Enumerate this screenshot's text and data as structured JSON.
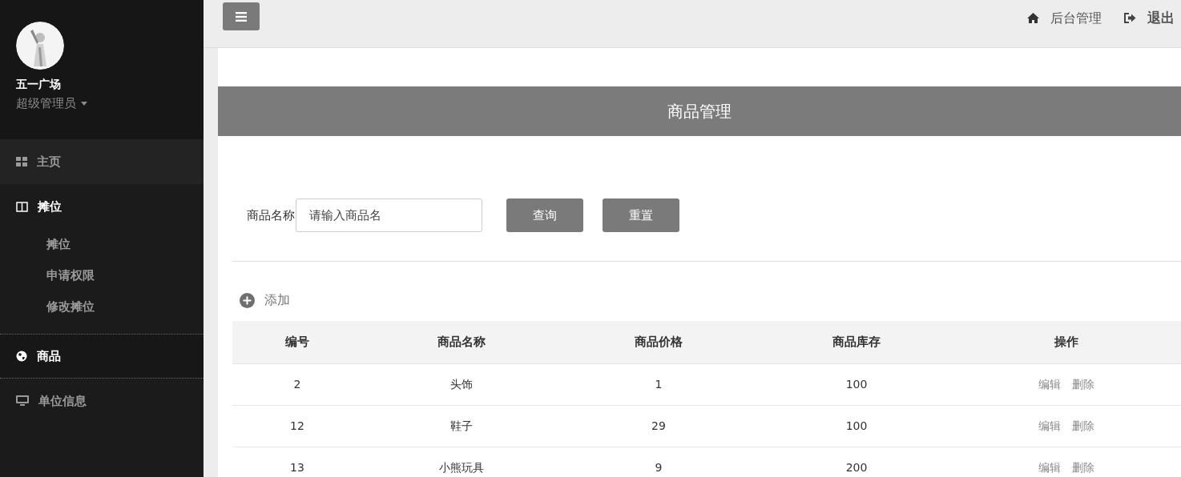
{
  "sidebar": {
    "user": {
      "name": "五一广场",
      "role": "超级管理员"
    },
    "items": [
      {
        "kind": "grid",
        "label": "主页",
        "selected": false,
        "expanded": false
      },
      {
        "kind": "columns",
        "label": "摊位",
        "selected": false,
        "expanded": true,
        "children": [
          {
            "label": "摊位"
          },
          {
            "label": "申请权限"
          },
          {
            "label": "修改摊位"
          }
        ]
      },
      {
        "kind": "globe",
        "label": "商品",
        "selected": true,
        "expanded": false
      },
      {
        "kind": "monitor",
        "label": "单位信息",
        "selected": false,
        "expanded": false
      }
    ]
  },
  "topbar": {
    "links": [
      {
        "kind": "home",
        "label": "后台管理"
      },
      {
        "kind": "logout",
        "label": "退出"
      }
    ]
  },
  "page": {
    "title": "商品管理",
    "search": {
      "label": "商品名称",
      "placeholder": "请输入商品名",
      "buttons": [
        "查询",
        "重置"
      ]
    },
    "add": "添加",
    "table": {
      "columns": [
        "编号",
        "商品名称",
        "商品价格",
        "商品库存",
        "操作"
      ],
      "rows": [
        {
          "cells": [
            "2",
            "头饰",
            "1",
            "100"
          ],
          "actions": [
            "编辑",
            "删除"
          ]
        },
        {
          "cells": [
            "12",
            "鞋子",
            "29",
            "100"
          ],
          "actions": [
            "编辑",
            "删除"
          ]
        },
        {
          "cells": [
            "13",
            "小熊玩具",
            "9",
            "200"
          ],
          "actions": [
            "编辑",
            "删除"
          ]
        }
      ]
    }
  }
}
